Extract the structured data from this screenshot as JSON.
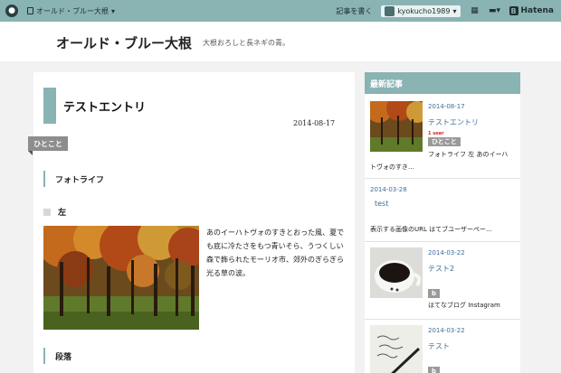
{
  "topbar": {
    "blog_selector": "オールド・ブルー大根",
    "write_label": "記事を書く",
    "username": "kyokucho1989",
    "service": "Hatena"
  },
  "header": {
    "title": "オールド・ブルー大根",
    "description": "大根おろしと長ネギの青。"
  },
  "entry": {
    "title": "テストエントリ",
    "date": "2014-08-17",
    "category": "ひとこと",
    "heading_h2_1": "フォトライフ",
    "heading_h3": "左",
    "paragraph": "あのイーハトヴォのすきとおった風、夏でも底に冷たさをもつ青いそら、うつくしい森で飾られたモーリオ市、郊外のぎらぎら光る草の波。",
    "heading_h2_2": "段落"
  },
  "sidebar": {
    "title": "最新記事",
    "items": [
      {
        "date": "2014-08-17",
        "title": "テストエントリ",
        "users": "1 user",
        "tag": "ひとこと",
        "excerpt_line1": "フォトライフ 左 あのイーハ",
        "excerpt_line2": "トヴォのすき…"
      },
      {
        "date": "2014-03-28",
        "title": "test",
        "excerpt": "表示する画像のURL はてブユーザーペー…"
      },
      {
        "date": "2014-03-22",
        "title": "テスト2",
        "tag": "b",
        "excerpt": "はてなブログ Instagram"
      },
      {
        "date": "2014-03-22",
        "title": "テスト",
        "tag": "b"
      }
    ]
  },
  "colors": {
    "accent": "#8ab3b3",
    "link": "#3a6f9c",
    "tag": "#9a9a9a"
  }
}
